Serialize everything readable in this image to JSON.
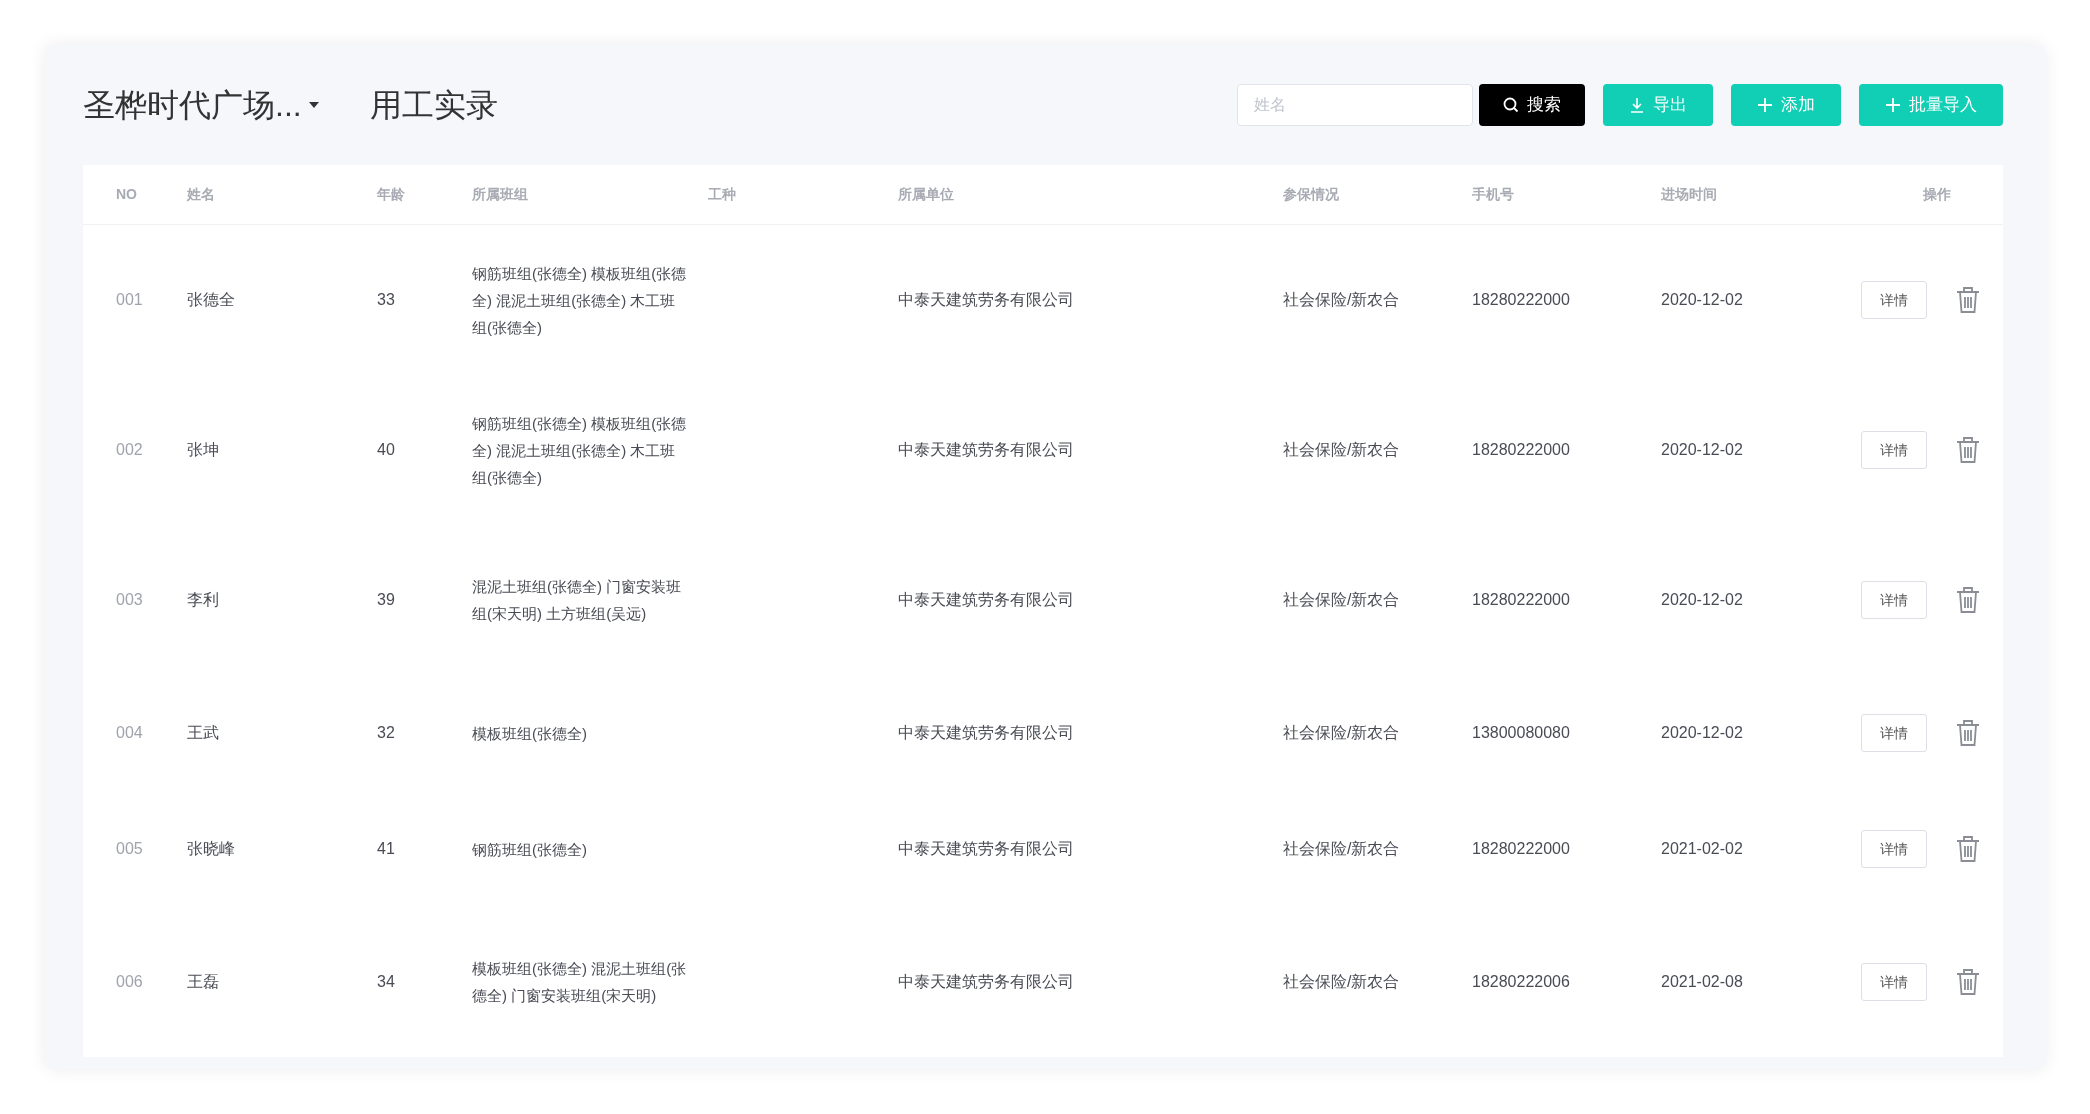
{
  "header": {
    "project": "圣桦时代广场...",
    "title": "用工实录"
  },
  "toolbar": {
    "search_placeholder": "姓名",
    "buttons": [
      {
        "label": "搜索",
        "kind": "search"
      },
      {
        "label": "导出",
        "kind": "export"
      },
      {
        "label": "添加",
        "kind": "add"
      },
      {
        "label": "批量导入",
        "kind": "add"
      }
    ]
  },
  "table": {
    "columns": [
      "NO",
      "姓名",
      "年龄",
      "所属班组",
      "工种",
      "所属单位",
      "参保情况",
      "手机号",
      "进场时间",
      "操作"
    ],
    "rows": [
      {
        "no": "001",
        "name": "张德全",
        "age": "33",
        "groups": "钢筋班组(张德全) 模板班组(张德全) 混泥土班组(张德全) 木工班组(张德全)",
        "company": "中泰天建筑劳务有限公司",
        "insurance": "社会保险/新农合",
        "phone": "18280222000",
        "date": "2020-12-02",
        "action": "详情"
      },
      {
        "no": "002",
        "name": "张坤",
        "age": "40",
        "groups": "钢筋班组(张德全) 模板班组(张德全) 混泥土班组(张德全) 木工班组(张德全)",
        "company": "中泰天建筑劳务有限公司",
        "insurance": "社会保险/新农合",
        "phone": "18280222000",
        "date": "2020-12-02",
        "action": "详情"
      },
      {
        "no": "003",
        "name": "李利",
        "age": "39",
        "groups": "混泥土班组(张德全) 门窗安装班组(宋天明) 土方班组(吴远)",
        "company": "中泰天建筑劳务有限公司",
        "insurance": "社会保险/新农合",
        "phone": "18280222000",
        "date": "2020-12-02",
        "action": "详情"
      },
      {
        "no": "004",
        "name": "王武",
        "age": "32",
        "groups": "模板班组(张德全)",
        "company": "中泰天建筑劳务有限公司",
        "insurance": "社会保险/新农合",
        "phone": "13800080080",
        "date": "2020-12-02",
        "action": "详情"
      },
      {
        "no": "005",
        "name": "张晓峰",
        "age": "41",
        "groups": "钢筋班组(张德全)",
        "company": "中泰天建筑劳务有限公司",
        "insurance": "社会保险/新农合",
        "phone": "18280222000",
        "date": "2021-02-02",
        "action": "详情"
      },
      {
        "no": "006",
        "name": "王磊",
        "age": "34",
        "groups": "模板班组(张德全) 混泥土班组(张德全) 门窗安装班组(宋天明)",
        "company": "中泰天建筑劳务有限公司",
        "insurance": "社会保险/新农合",
        "phone": "18280222006",
        "date": "2021-02-08",
        "action": "详情"
      }
    ]
  }
}
